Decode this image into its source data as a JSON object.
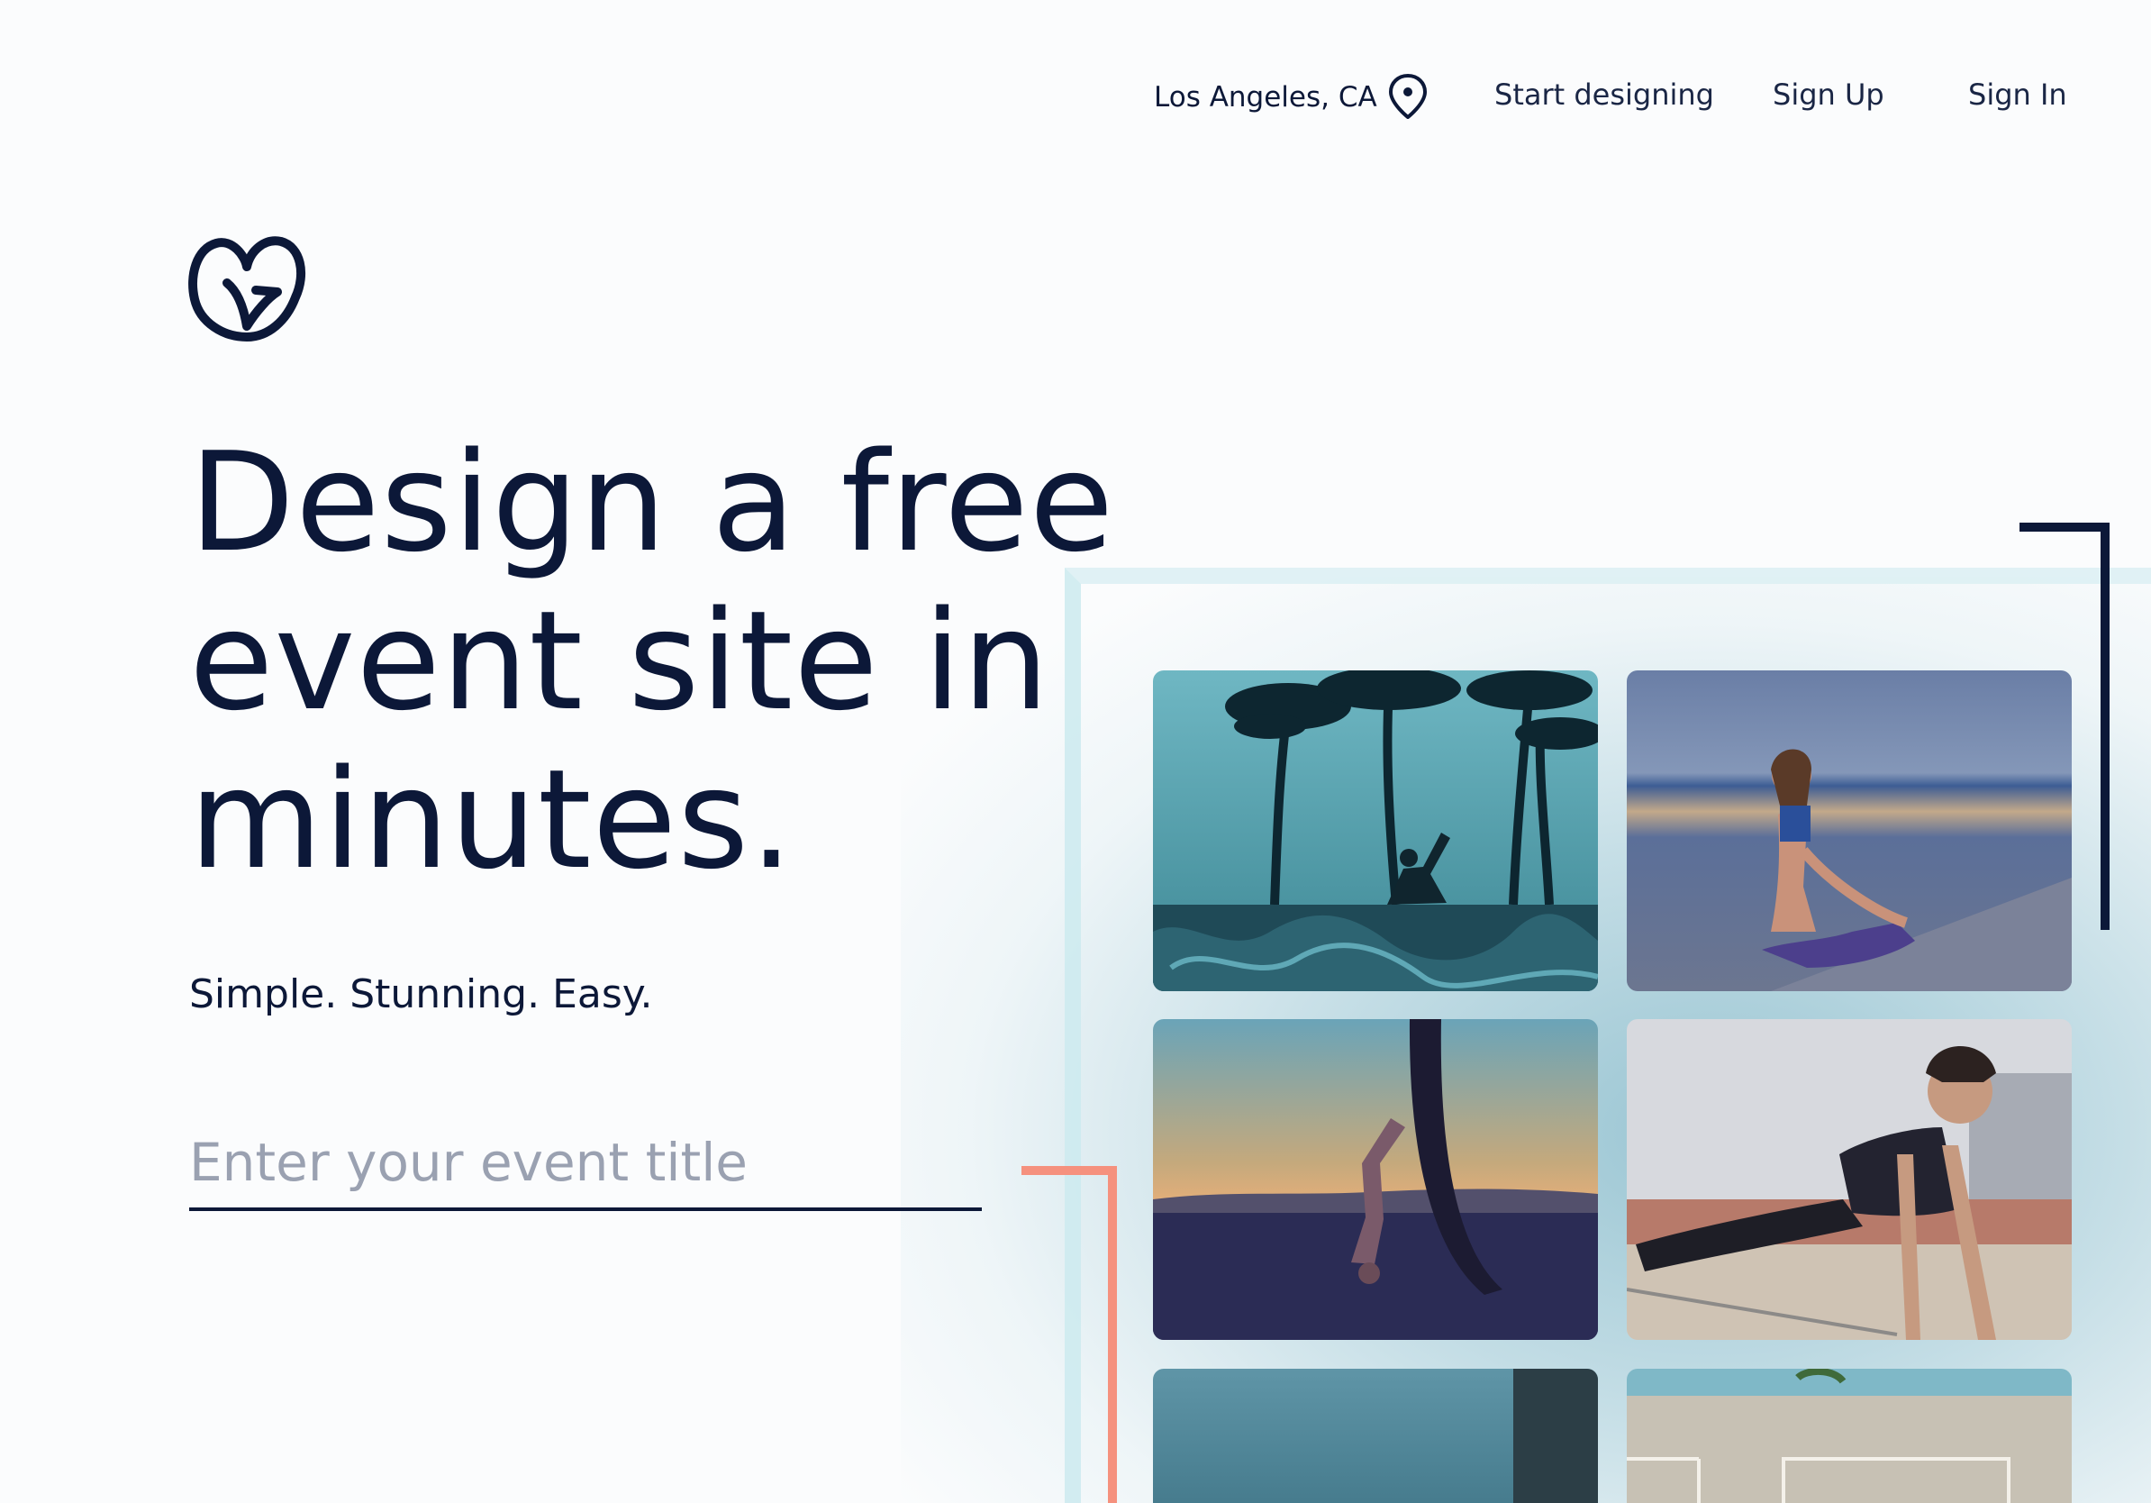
{
  "nav": {
    "location": "Los Angeles, CA",
    "location_icon": "map-pin-icon",
    "start_designing": "Start designing",
    "sign_up": "Sign Up",
    "sign_in": "Sign In"
  },
  "logo": {
    "icon": "godaddy-g-logo"
  },
  "hero": {
    "headline": "Design a free event site in minutes.",
    "tagline": "Simple. Stunning. Easy.",
    "input_placeholder": "Enter your event title",
    "input_value": ""
  },
  "gallery": {
    "photos": [
      {
        "name": "yoga-palm-trees-photo"
      },
      {
        "name": "yoga-stretch-beach-photo"
      },
      {
        "name": "handstand-sunset-photo"
      },
      {
        "name": "pushup-beach-photo"
      },
      {
        "name": "skatepark-photo"
      },
      {
        "name": "court-wall-photo"
      }
    ]
  },
  "colors": {
    "navy": "#0c1838",
    "coral": "#f5917e",
    "placeholder_gray": "#9aa1b1",
    "teal_glow": "#78b2c4"
  }
}
